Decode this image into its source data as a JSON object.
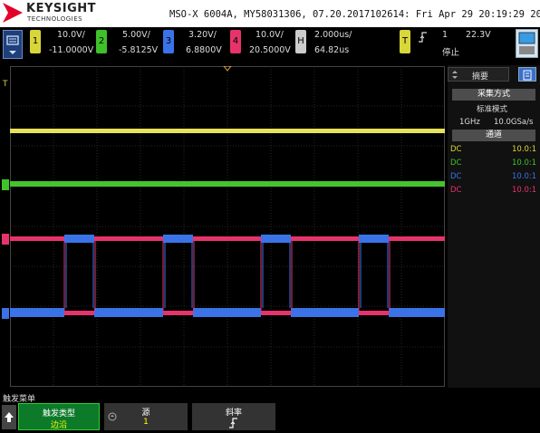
{
  "header": {
    "brand": "KEYSIGHT",
    "brand_sub": "TECHNOLOGIES",
    "instrument_info": "MSO-X 6004A, MY58031306, 07.20.2017102614: Fri Apr 29 20:19:29 2022"
  },
  "channels": [
    {
      "num": "1",
      "scale": "10.0V/",
      "offset": "-11.0000V",
      "color": "#d9d63a"
    },
    {
      "num": "2",
      "scale": "5.00V/",
      "offset": "-5.8125V",
      "color": "#3fc12a"
    },
    {
      "num": "3",
      "scale": "3.20V/",
      "offset": "6.8800V",
      "color": "#3a73e8"
    },
    {
      "num": "4",
      "scale": "10.0V/",
      "offset": "20.5000V",
      "color": "#e6336b"
    }
  ],
  "horizontal": {
    "label": "H",
    "timebase": "2.000us/",
    "delay": "64.82us"
  },
  "trigger": {
    "label": "T",
    "slope_icon": "rising-edge-icon",
    "source": "1",
    "level": "22.3V",
    "state": "停止"
  },
  "right_panel": {
    "tab_summary": "摘要",
    "acq_button": "采集方式",
    "acq_mode": "标准模式",
    "bandwidth": "1GHz",
    "sample_rate": "10.0GSa/s",
    "channel_button": "通道",
    "channel_rows": [
      {
        "coupling": "DC",
        "probe": "10.0:1",
        "color": "#d9d63a"
      },
      {
        "coupling": "DC",
        "probe": "10.0:1",
        "color": "#3fc12a"
      },
      {
        "coupling": "DC",
        "probe": "10.0:1",
        "color": "#3a73e8"
      },
      {
        "coupling": "DC",
        "probe": "10.0:1",
        "color": "#e6336b"
      }
    ]
  },
  "bottom": {
    "menu_title": "触发菜单",
    "softkeys": [
      {
        "label": "触发类型",
        "value": "边沿"
      },
      {
        "label": "源",
        "value": "1"
      },
      {
        "label": "斜率",
        "value": "rising-edge-icon"
      }
    ]
  }
}
